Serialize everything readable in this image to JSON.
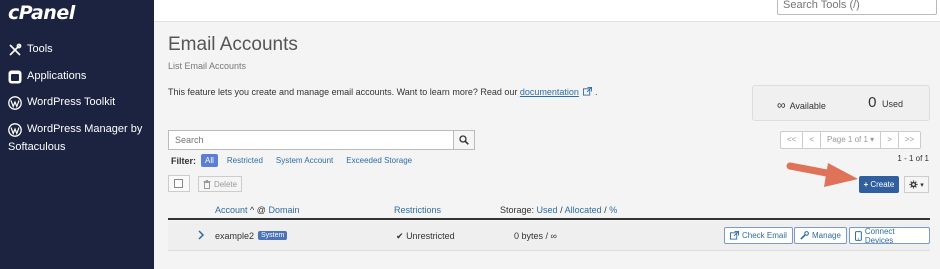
{
  "sidebar": {
    "logo": "cPanel",
    "items": [
      {
        "label": "Tools",
        "icon": "tools-icon"
      },
      {
        "label": "Applications",
        "icon": "applications-icon"
      },
      {
        "label": "WordPress Toolkit",
        "icon": "wordpress-icon"
      },
      {
        "label": "WordPress Manager by Softaculous",
        "line1": "WordPress Manager by",
        "line2": "Softaculous",
        "icon": "wordpress-icon"
      }
    ]
  },
  "topbar": {
    "search_placeholder": "Search Tools (/)"
  },
  "page": {
    "title": "Email Accounts",
    "subtitle": "List Email Accounts",
    "description": "This feature lets you create and manage email accounts. Want to learn more? Read our",
    "doc_link": "documentation",
    "desc_tail": "."
  },
  "summary": {
    "available_symbol": "∞",
    "available_label": "Available",
    "used_count": "0",
    "used_label": "Used"
  },
  "search": {
    "placeholder": "Search"
  },
  "pager": {
    "first": "<<",
    "prev": "<",
    "page_label": "Page 1 of 1",
    "next": ">",
    "last": ">>"
  },
  "filter": {
    "label": "Filter:",
    "options": [
      {
        "label": "All",
        "active": true
      },
      {
        "label": "Restricted",
        "active": false
      },
      {
        "label": "System Account",
        "active": false
      },
      {
        "label": "Exceeded Storage",
        "active": false
      }
    ],
    "range": "1 - 1 of 1"
  },
  "toolbar": {
    "delete_label": "Delete",
    "create_label": "Create"
  },
  "table": {
    "headers": {
      "account": "Account",
      "at_sep": "@",
      "domain": "Domain",
      "restrictions": "Restrictions",
      "storage_prefix": "Storage:",
      "used": "Used",
      "allocated": "Allocated",
      "percent": "%",
      "slash": "/"
    },
    "rows": [
      {
        "account": "example2",
        "badge": "System",
        "restriction_mark": "✔",
        "restrictions": "Unrestricted",
        "storage": "0 bytes / ∞",
        "actions": [
          "Check Email",
          "Manage",
          "Connect Devices"
        ]
      }
    ]
  },
  "colors": {
    "sidebar_bg": "#1c2340",
    "primary_button": "#2f5f9e",
    "link": "#2e6da4",
    "arrow": "#e0725a"
  }
}
